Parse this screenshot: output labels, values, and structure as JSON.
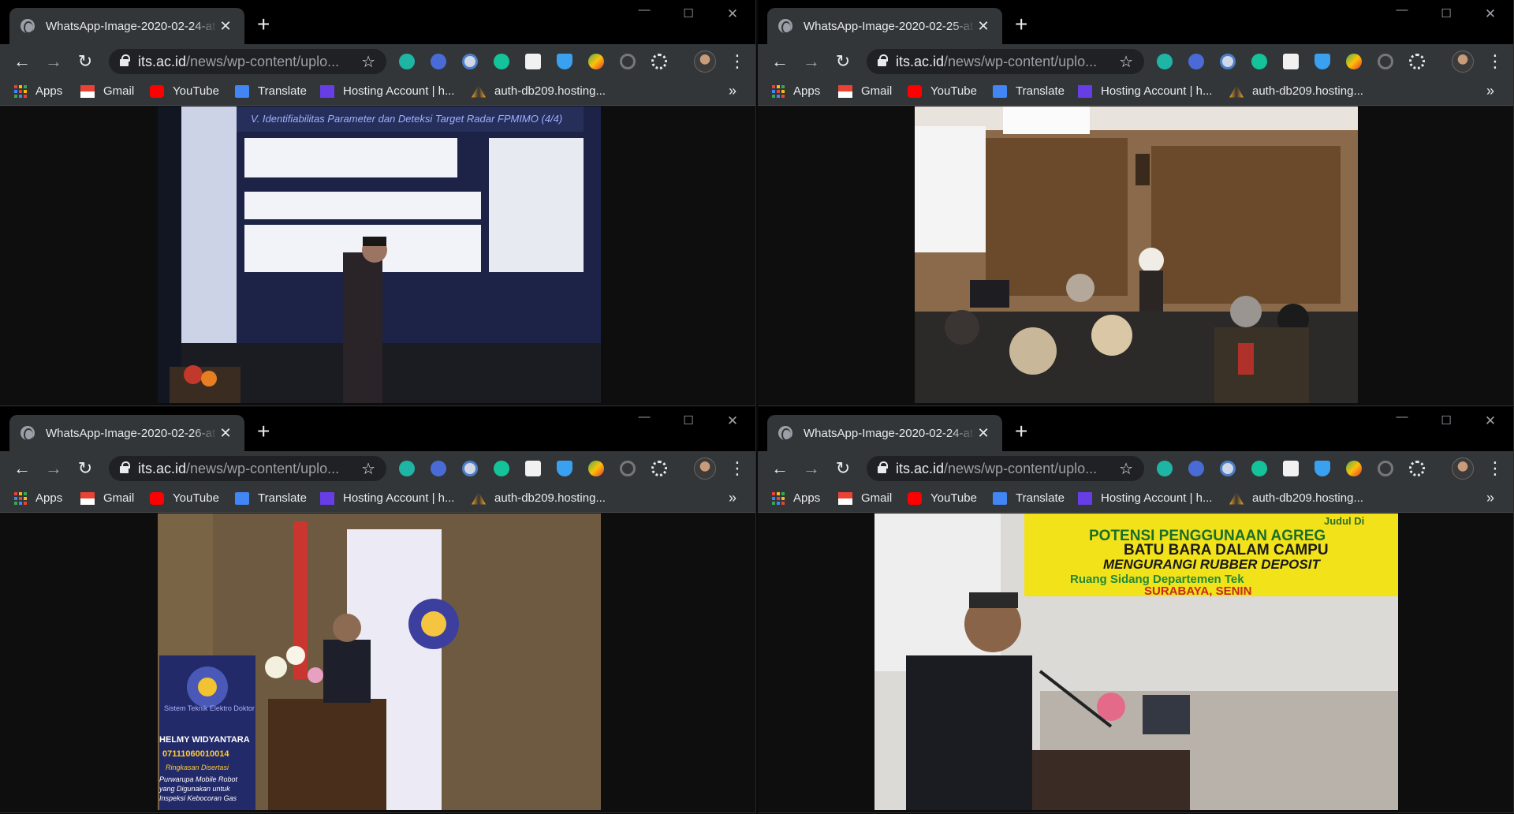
{
  "bookmarks": [
    {
      "label": "Apps",
      "icon": "apps-grid-icon"
    },
    {
      "label": "Gmail",
      "icon": "gmail-icon"
    },
    {
      "label": "YouTube",
      "icon": "youtube-icon"
    },
    {
      "label": "Translate",
      "icon": "google-translate-icon"
    },
    {
      "label": "Hosting Account | h...",
      "icon": "hosting-icon"
    },
    {
      "label": "auth-db209.hosting...",
      "icon": "auth-db-icon"
    }
  ],
  "url_host": "its.ac.id",
  "url_path": "/news/wp-content/uplo...",
  "windows": [
    {
      "tab_title": "WhatsApp-Image-2020-02-24-at",
      "photo_description": "Presenter with microphone in front of projected slide"
    },
    {
      "tab_title": "WhatsApp-Image-2020-02-25-at",
      "photo_description": "Woman in hijab presenting to seated audience"
    },
    {
      "tab_title": "WhatsApp-Image-2020-02-26-at",
      "photo_description": "Speaker at podium with flowers, ITS logo and banner"
    },
    {
      "tab_title": "WhatsApp-Image-2020-02-24-at",
      "photo_description": "Man speaking at microphone below yellow banner"
    }
  ],
  "banner_slide": {
    "heading": "V. Identifiabilitas Parameter dan Deteksi Target Radar FPMIMO (4/4)"
  },
  "banner_yellow": {
    "line1": "Judul Di",
    "line2": "POTENSI PENGGUNAAN AGREG",
    "line3": "BATU BARA DALAM CAMPU",
    "line4": "MENGURANGI RUBBER DEPOSIT",
    "line5": "Ruang Sidang Departemen Tek",
    "line6": "SURABAYA, SENIN"
  },
  "banner_standee": {
    "line1": "Sistem Teknik Elektro Doktor",
    "line2": "HELMY WIDYANTARA",
    "line3": "07111060010014",
    "line4": "Ringkasan Disertasi",
    "line5": "Purwarupa Mobile Robot",
    "line6": "yang Digunakan untuk",
    "line7": "Inspeksi Kebocoran Gas"
  },
  "colors": {
    "titlebar_bg": "#000000",
    "toolbar_bg": "#323639",
    "omnibox_bg": "#202124",
    "text": "#e8eaed",
    "muted": "#9aa0a6"
  }
}
